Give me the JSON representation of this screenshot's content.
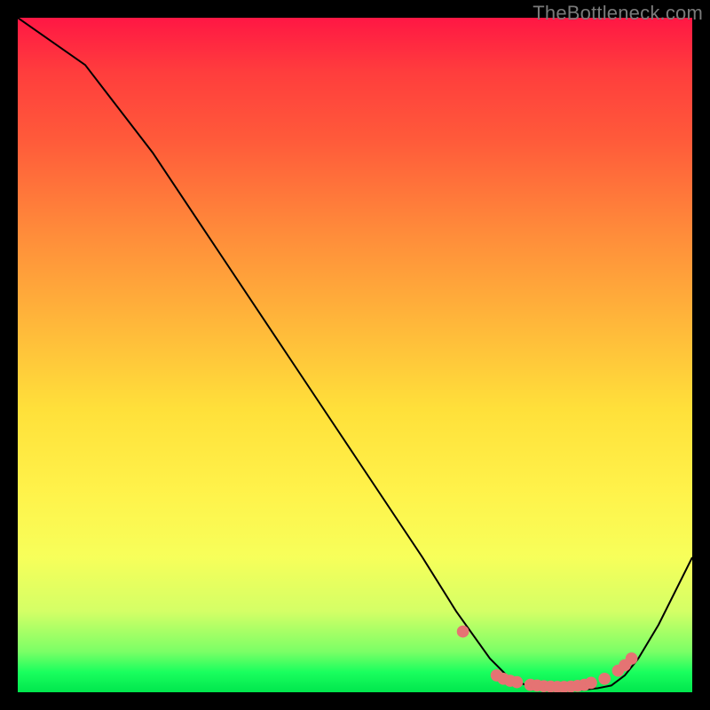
{
  "watermark": "TheBottleneck.com",
  "chart_data": {
    "type": "line",
    "title": "",
    "xlabel": "",
    "ylabel": "",
    "xlim": [
      0,
      100
    ],
    "ylim": [
      0,
      100
    ],
    "grid": false,
    "legend": false,
    "series": [
      {
        "name": "bottleneck-curve",
        "color": "#000000",
        "x": [
          0,
          10,
          20,
          30,
          40,
          50,
          60,
          65,
          70,
          73,
          76,
          78,
          80,
          82,
          84,
          86,
          88,
          90,
          92,
          95,
          100
        ],
        "values": [
          100,
          93,
          80,
          65,
          50,
          35,
          20,
          12,
          5,
          2,
          0.8,
          0.5,
          0.3,
          0.3,
          0.4,
          0.6,
          1.0,
          2.5,
          5,
          10,
          20
        ]
      }
    ],
    "markers": {
      "name": "sweet-spot-dots",
      "color": "#e57373",
      "x": [
        66,
        71,
        72,
        73,
        74,
        76,
        77,
        78,
        79,
        80,
        81,
        82,
        83,
        84,
        85,
        87,
        89,
        90,
        91
      ],
      "values": [
        9,
        2.5,
        2,
        1.7,
        1.5,
        1.1,
        1.0,
        0.9,
        0.85,
        0.8,
        0.8,
        0.85,
        0.95,
        1.1,
        1.4,
        2.0,
        3.2,
        4.0,
        5.0
      ]
    }
  }
}
